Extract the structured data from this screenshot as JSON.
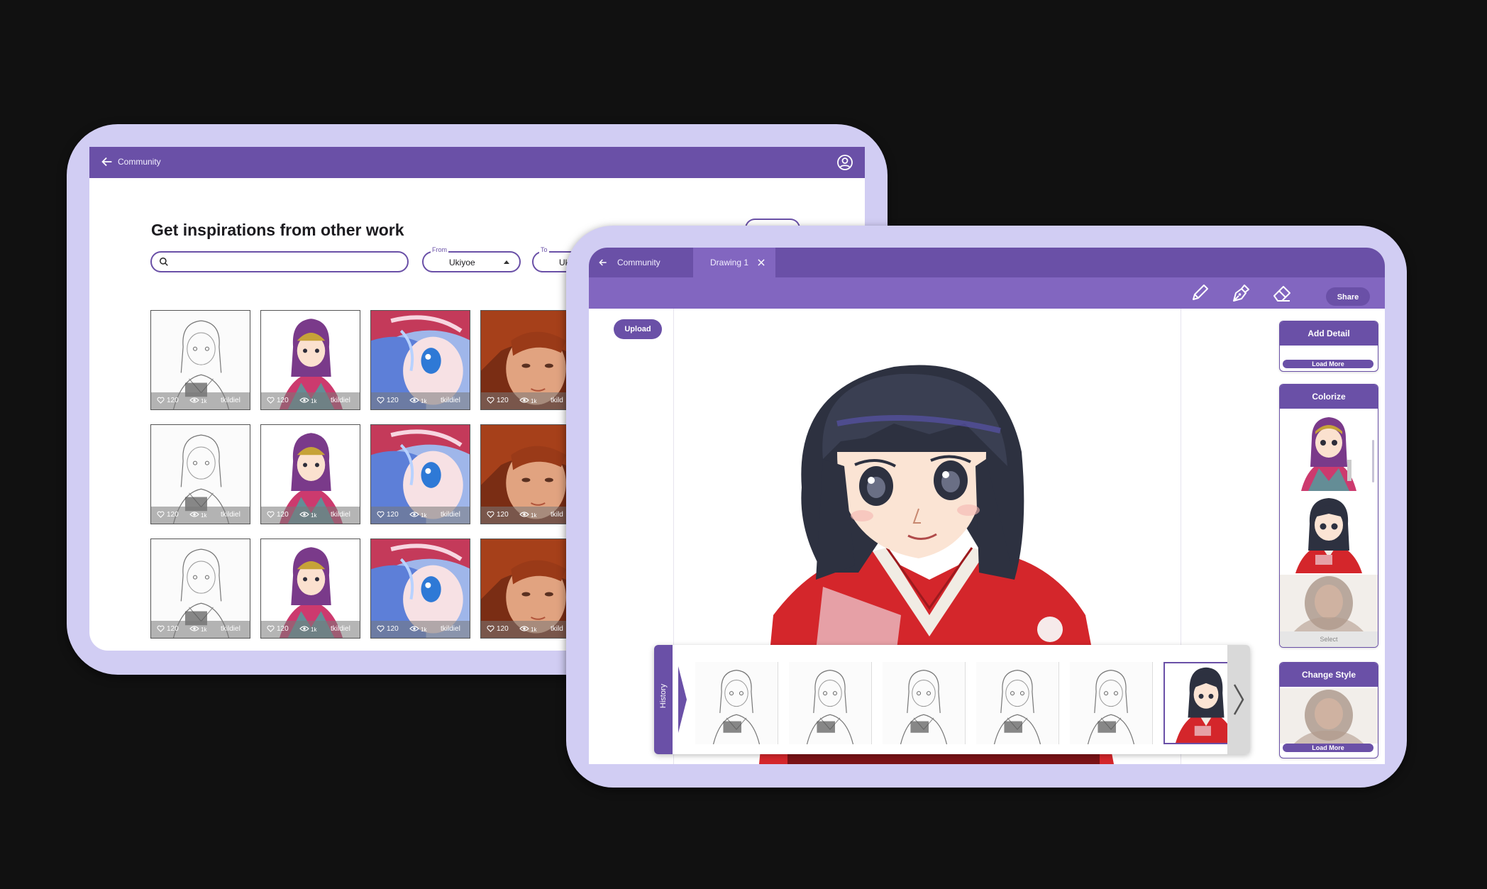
{
  "community_screen": {
    "topbar": {
      "title": "Community"
    },
    "heading": "Get inspirations from other work",
    "search": {
      "placeholder": ""
    },
    "from_select": {
      "label": "From",
      "value": "Ukiyoe"
    },
    "to_select": {
      "label": "To",
      "value": "Uk"
    },
    "grid_rows": [
      [
        {
          "style": "sketch",
          "likes": "120",
          "views": "1k",
          "user": "tkildiel"
        },
        {
          "style": "color",
          "likes": "120",
          "views": "1k",
          "user": "tkildiel"
        },
        {
          "style": "blue",
          "likes": "120",
          "views": "1k",
          "user": "tkildiel"
        },
        {
          "style": "painting",
          "likes": "120",
          "views": "1k",
          "user": "tkild"
        }
      ],
      [
        {
          "style": "sketch",
          "likes": "120",
          "views": "1k",
          "user": "tkildiel"
        },
        {
          "style": "color",
          "likes": "120",
          "views": "1k",
          "user": "tkildiel"
        },
        {
          "style": "blue",
          "likes": "120",
          "views": "1k",
          "user": "tkildiel"
        },
        {
          "style": "painting",
          "likes": "120",
          "views": "1k",
          "user": "tkild"
        }
      ],
      [
        {
          "style": "sketch",
          "likes": "120",
          "views": "1k",
          "user": "tkildiel"
        },
        {
          "style": "color",
          "likes": "120",
          "views": "1k",
          "user": "tkildiel"
        },
        {
          "style": "blue",
          "likes": "120",
          "views": "1k",
          "user": "tkildiel"
        },
        {
          "style": "painting",
          "likes": "120",
          "views": "1k",
          "user": "tkild"
        }
      ]
    ]
  },
  "editor_screen": {
    "tabs": [
      {
        "label": "Community"
      },
      {
        "label": "Drawing 1"
      }
    ],
    "tools": [
      "pencil-icon",
      "pen-nib-icon",
      "eraser-icon"
    ],
    "share_label": "Share",
    "upload_label": "Upload",
    "add_detail": {
      "title": "Add Detail",
      "load_more": "Load More"
    },
    "colorize": {
      "title": "Colorize",
      "select_label": "Select"
    },
    "change_style": {
      "title": "Change Style",
      "load_more": "Load More"
    },
    "history": {
      "label": "History",
      "thumb_count_sketch": 5,
      "selected_index": 5
    }
  },
  "colors": {
    "primary": "#6a50a7",
    "primary_light": "#8266c0",
    "tablet_frame": "#d1cdf3",
    "background": "#111111",
    "kimono_red": "#d4262b",
    "hair_navy": "#2d3140"
  }
}
